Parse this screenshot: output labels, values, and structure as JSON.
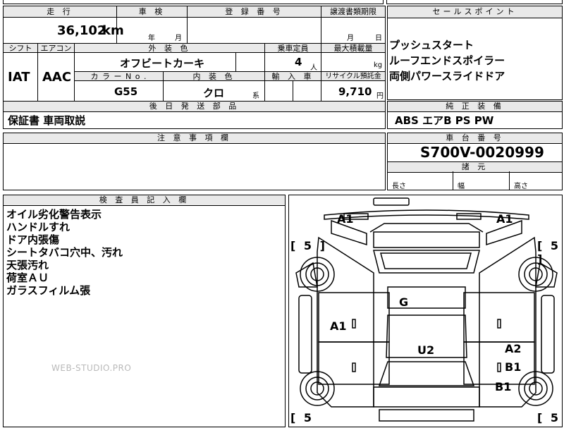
{
  "headers": {
    "mileage": "走 行",
    "shaken": "車 検",
    "registration": "登 録 番 号",
    "transfer_deadline": "譲渡書類期限",
    "sales_points": "セールスポイント",
    "shift": "シフト",
    "aircon": "エアコン",
    "exterior_color": "外 装 色",
    "capacity": "乗車定員",
    "max_load": "最大積載量",
    "color_no": "カ ラ ー N o .",
    "interior_color": "内 装 色",
    "import": "輸 入 車",
    "recycle": "リサイクル預託金",
    "later_parts": "後 日 発 送 部 品",
    "standard_equipment": "純 正 装 備",
    "notes": "注 意 事 項 欄",
    "chassis_no": "車 台 番 号",
    "dimensions": "諸 元",
    "inspector": "検 査 員 記 入 欄"
  },
  "vehicle": {
    "mileage": "36,102",
    "mileage_unit": "km",
    "shaken_year_unit": "年",
    "shaken_month_unit": "月",
    "transfer_month_unit": "月",
    "transfer_day_unit": "日",
    "shift": "IAT",
    "aircon": "AAC",
    "exterior_color": "オフビートカーキ",
    "capacity": "4",
    "capacity_unit": "人",
    "load_unit": "kg",
    "color_no": "G55",
    "interior_color": "クロ",
    "interior_suffix": "系",
    "recycle_fee": "9,710",
    "recycle_unit": "円",
    "later_parts": "保証書 車両取説",
    "standard_equipment": "ABS エアB PS PW",
    "chassis_no": "S700V-0020999",
    "dim_length": "長さ",
    "dim_width": "幅",
    "dim_height": "高さ"
  },
  "sales_points": [
    "プッシュスタート",
    "ルーフエンドスポイラー",
    "両側パワースライドドア"
  ],
  "inspector_remarks": [
    "オイル劣化警告表示",
    "ハンドルすれ",
    "ドア内張傷",
    "シートタバコ穴中、汚れ",
    "天張汚れ",
    "荷室ＡＵ",
    "ガラスフィルム張"
  ],
  "diagram": {
    "front_left": "A1",
    "front_right": "A1",
    "roof": "G",
    "left_door": "A1",
    "floor": "U2",
    "right_rear_1": "A2",
    "right_rear_2": "B1",
    "right_rear_3": "B1",
    "tire_fl": "[ 5 ]",
    "tire_fr": "[ 5 ]",
    "tire_rl": "[ 5",
    "tire_rr": "[ 5"
  },
  "watermark": "WEB-STUDIO.PRO"
}
